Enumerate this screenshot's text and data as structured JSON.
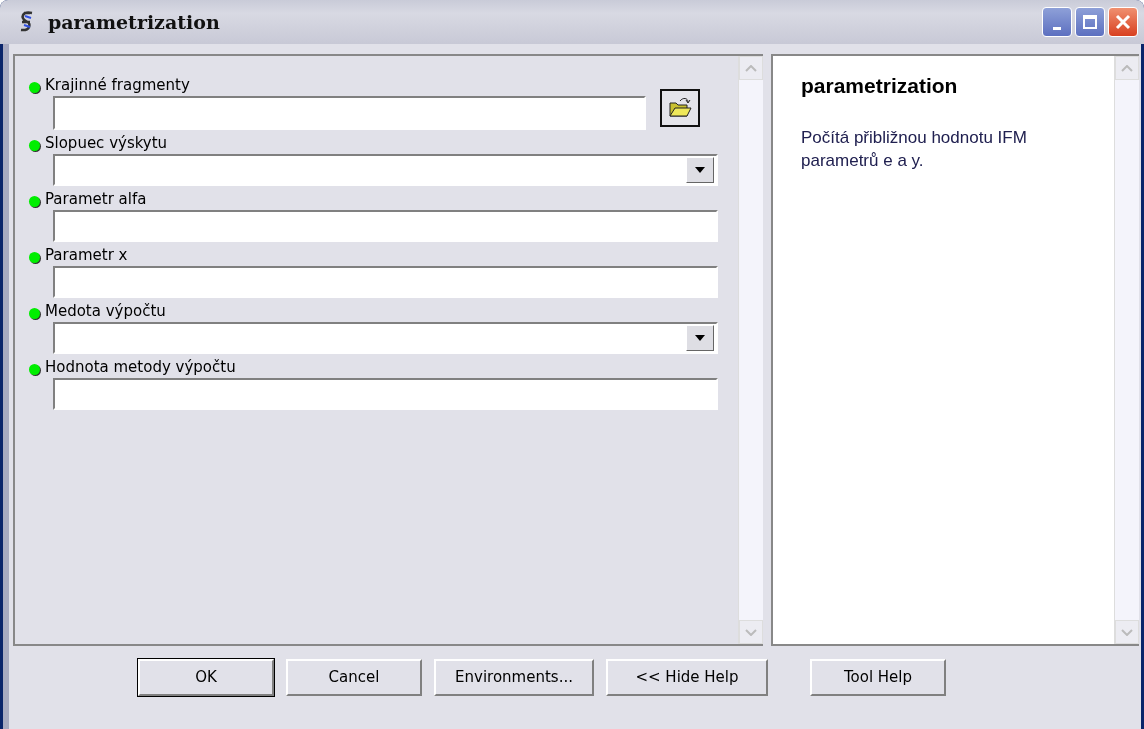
{
  "window": {
    "title": "parametrization"
  },
  "parameters": [
    {
      "label": "Krajinné fragmenty",
      "kind": "file",
      "required": true
    },
    {
      "label": "Slopuec výskytu",
      "kind": "dropdown",
      "required": true
    },
    {
      "label": "Parametr alfa",
      "kind": "text",
      "required": true
    },
    {
      "label": "Parametr x",
      "kind": "text",
      "required": true
    },
    {
      "label": "Medota výpočtu",
      "kind": "dropdown",
      "required": true
    },
    {
      "label": "Hodnota metody výpočtu",
      "kind": "text",
      "required": true
    }
  ],
  "help": {
    "title": "parametrization",
    "text": "Počítá přibližnou hodnotu IFM parametrů e a y."
  },
  "buttons": [
    {
      "label": "OK",
      "default": true
    },
    {
      "label": "Cancel",
      "default": false
    },
    {
      "label": "Environments...",
      "default": false
    },
    {
      "label": "<< Hide Help",
      "default": false
    },
    {
      "label": "Tool Help",
      "default": false
    }
  ]
}
